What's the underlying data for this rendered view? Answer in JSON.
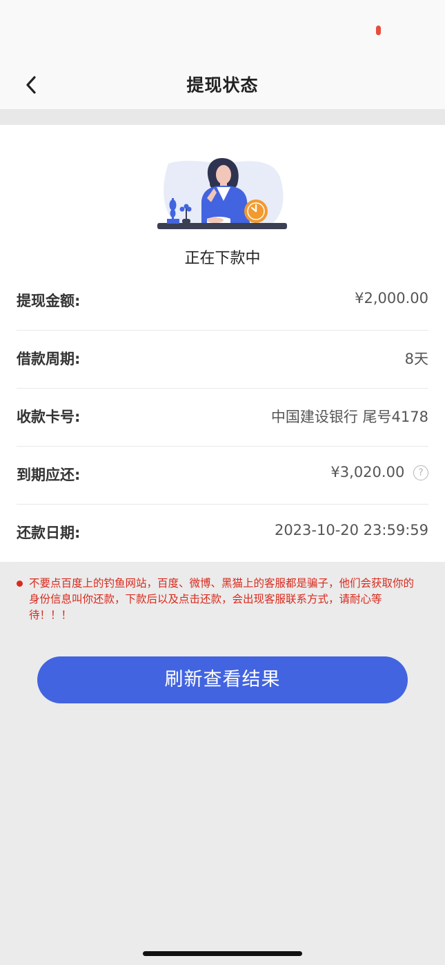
{
  "colors": {
    "accent": "#4264e0",
    "warning": "#d9291c",
    "status_indicator": "#e84d3d",
    "illustration_clock": "#f29a2e",
    "illustration_blob": "#e7ecf8"
  },
  "header": {
    "back_icon": "chevron-left-icon",
    "title": "提现状态"
  },
  "status": {
    "illustration": "woman-waiting-clock-illustration",
    "text": "正在下款中"
  },
  "details": [
    {
      "label": "提现金额:",
      "value": "¥2,000.00"
    },
    {
      "label": "借款周期:",
      "value": "8天"
    },
    {
      "label": "收款卡号:",
      "value": "中国建设银行 尾号4178"
    },
    {
      "label": "到期应还:",
      "value": "¥3,020.00",
      "help_icon": "?"
    },
    {
      "label": "还款日期:",
      "value": "2023-10-20 23:59:59"
    }
  ],
  "notice": {
    "text": "不要点百度上的钓鱼网站，百度、微博、黑猫上的客服都是骗子，他们会获取你的身份信息叫你还款，下款后以及点击还款，会出现客服联系方式，请耐心等待！！！"
  },
  "actions": {
    "refresh_label": "刷新查看结果"
  }
}
